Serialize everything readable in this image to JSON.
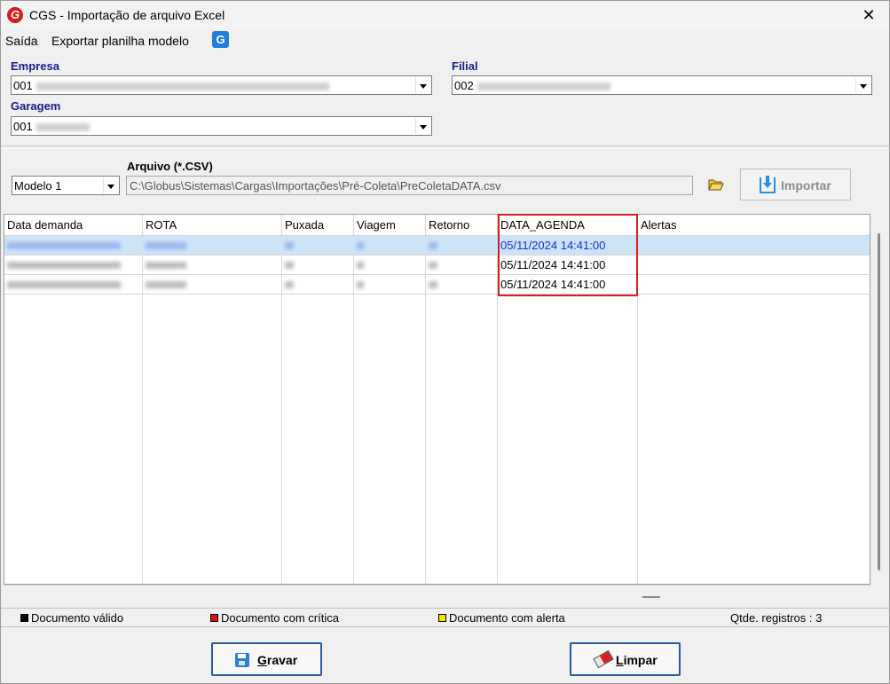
{
  "window": {
    "title": "CGS - Importação de arquivo Excel",
    "close_glyph": "✕",
    "logo_letter": "G"
  },
  "menu": {
    "items": [
      "Saída",
      "Exportar planilha modelo"
    ],
    "logo_letter": "G"
  },
  "filters": {
    "empresa": {
      "label": "Empresa",
      "code": "001"
    },
    "filial": {
      "label": "Filial",
      "code": "002"
    },
    "garagem": {
      "label": "Garagem",
      "code": "001"
    }
  },
  "file": {
    "model_select": "Modelo 1",
    "arquivo_label": "Arquivo (*.CSV)",
    "path": "C:\\Globus\\Sistemas\\Cargas\\Importações\\Pré-Coleta\\PreColetaDATA.csv",
    "import_button": "Importar",
    "folder_icon": "folder-open-icon"
  },
  "grid": {
    "columns": [
      "Data demanda",
      "ROTA",
      "Puxada",
      "Viagem",
      "Retorno",
      "DATA_AGENDA",
      "Alertas"
    ],
    "rows": [
      {
        "data_agenda": "05/11/2024 14:41:00",
        "selected": true
      },
      {
        "data_agenda": "05/11/2024 14:41:00",
        "selected": false
      },
      {
        "data_agenda": "05/11/2024 14:41:00",
        "selected": false
      }
    ]
  },
  "legend": {
    "valid": "Documento válido",
    "critica": "Documento com crítica",
    "alerta": "Documento com alerta",
    "count": "Qtde. registros : 3",
    "colors": {
      "valid": "#000000",
      "critica": "#e01010",
      "alerta": "#f4e400"
    }
  },
  "buttons": {
    "gravar_first": "G",
    "gravar_rest": "ravar",
    "limpar_first": "L",
    "limpar_rest": "impar"
  },
  "colors": {
    "label_blue": "#1a1a8c",
    "selected_row": "#cde4f7",
    "highlight_border": "#d62020"
  }
}
